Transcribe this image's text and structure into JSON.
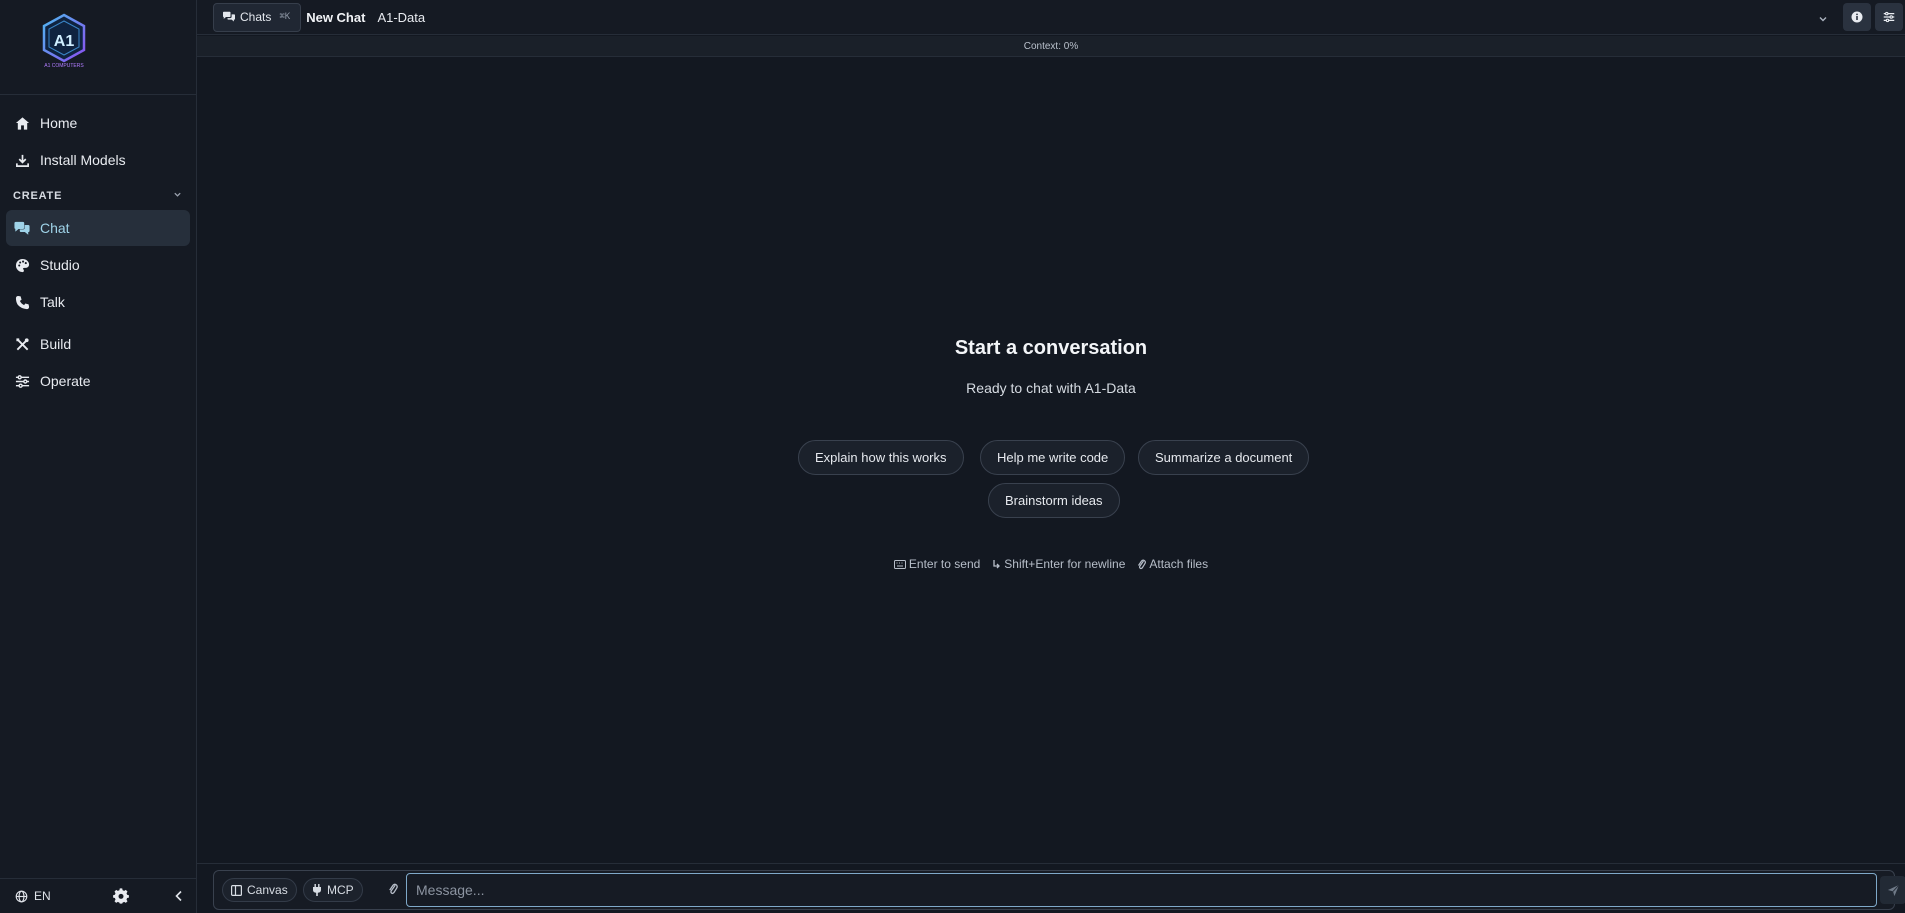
{
  "sidebar": {
    "logo_text": "A1 COMPUTERS",
    "items_top": [
      {
        "label": "Home",
        "icon": "home-icon"
      },
      {
        "label": "Install Models",
        "icon": "download-icon"
      }
    ],
    "section_label": "CREATE",
    "items_create": [
      {
        "label": "Chat",
        "icon": "chat-icon",
        "active": true
      },
      {
        "label": "Studio",
        "icon": "palette-icon"
      },
      {
        "label": "Talk",
        "icon": "phone-icon"
      }
    ],
    "items_bottom": [
      {
        "label": "Build",
        "icon": "tools-icon"
      },
      {
        "label": "Operate",
        "icon": "sliders-icon"
      }
    ],
    "footer": {
      "language": "EN"
    }
  },
  "topbar": {
    "chats_label": "Chats",
    "chats_shortcut": "⌘K",
    "new_chat_label": "New Chat",
    "model_name": "A1-Data"
  },
  "context_label": "Context: 0%",
  "main": {
    "title": "Start a conversation",
    "subtitle": "Ready to chat with A1-Data",
    "suggestions": [
      "Explain how this works",
      "Help me write code",
      "Summarize a document",
      "Brainstorm ideas"
    ],
    "hints": [
      "Enter to send",
      "Shift+Enter for newline",
      "Attach files"
    ]
  },
  "composer": {
    "canvas_label": "Canvas",
    "mcp_label": "MCP",
    "placeholder": "Message..."
  },
  "colors": {
    "background": "#131821",
    "sidebar": "#151a23",
    "active_nav": "#262f3b",
    "accent": "#9fd3e8",
    "input_focus": "#7fa9c9"
  }
}
